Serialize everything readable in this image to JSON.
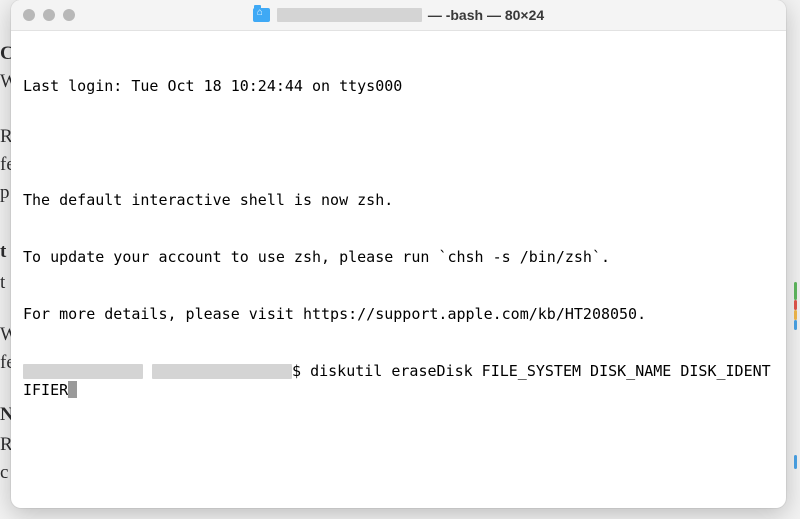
{
  "window": {
    "title_user": "████████████████",
    "title_suffix": "— -bash — 80×24"
  },
  "terminal": {
    "last_login": "Last login: Tue Oct 18 10:24:44 on ttys000",
    "blank1": "",
    "msg1": "The default interactive shell is now zsh.",
    "msg2": "To update your account to use zsh, please run `chsh -s /bin/zsh`.",
    "msg3": "For more details, please visit https://support.apple.com/kb/HT208050.",
    "prompt_sep": "$",
    "command": "diskutil eraseDisk FILE_SYSTEM DISK_NAME DISK_IDENTIFIER"
  },
  "background_fragments": {
    "f0": "C",
    "f1": "W",
    "f2": "R",
    "f3": "fe",
    "f4": "p",
    "f5": "t",
    "f6": "t",
    "f7": "W",
    "f8": "fe",
    "f9": "N",
    "f10": "R",
    "f11": "c"
  }
}
